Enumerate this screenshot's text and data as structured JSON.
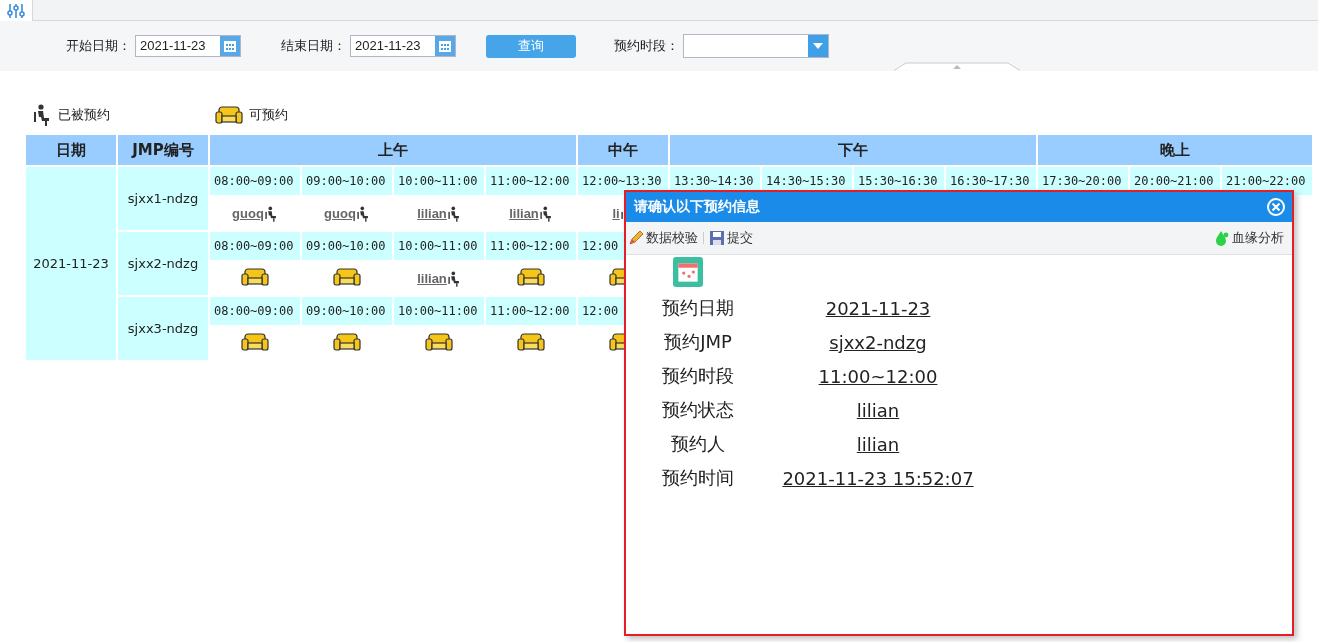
{
  "filter": {
    "start_label": "开始日期：",
    "start_value": "2021-11-23",
    "end_label": "结束日期：",
    "end_value": "2021-11-23",
    "query_button": "查询",
    "period_label": "预约时段："
  },
  "legend": [
    {
      "kind": "booked",
      "label": "已被预约"
    },
    {
      "kind": "free",
      "label": "可预约"
    }
  ],
  "table": {
    "columns": [
      "日期",
      "JMP编号"
    ],
    "period_labels": [
      "上午",
      "中午",
      "下午",
      "晚上"
    ],
    "date": "2021-11-23",
    "rows": [
      {
        "jmp": "sjxx1-ndzg",
        "periods": [
          [
            {
              "time": "08:00~09:00",
              "kind": "booked",
              "user": "guoq"
            },
            {
              "time": "09:00~10:00",
              "kind": "booked",
              "user": "guoq"
            },
            {
              "time": "10:00~11:00",
              "kind": "booked",
              "user": "lilian"
            },
            {
              "time": "11:00~12:00",
              "kind": "booked",
              "user": "lilian"
            }
          ],
          [
            {
              "time": "12:00~13:30",
              "kind": "booked",
              "user": "li"
            }
          ],
          [
            {
              "time": "13:30~14:30"
            },
            {
              "time": "14:30~15:30"
            },
            {
              "time": "15:30~16:30"
            },
            {
              "time": "16:30~17:30"
            }
          ],
          [
            {
              "time": "17:30~20:00"
            },
            {
              "time": "20:00~21:00"
            },
            {
              "time": "21:00~22:00"
            }
          ]
        ]
      },
      {
        "jmp": "sjxx2-ndzg",
        "periods": [
          [
            {
              "time": "08:00~09:00",
              "kind": "free"
            },
            {
              "time": "09:00~10:00",
              "kind": "free"
            },
            {
              "time": "10:00~11:00",
              "kind": "booked",
              "user": "lilian"
            },
            {
              "time": "11:00~12:00",
              "kind": "free"
            }
          ],
          [
            {
              "time": "12:00",
              "kind": "free"
            }
          ]
        ]
      },
      {
        "jmp": "sjxx3-ndzg",
        "periods": [
          [
            {
              "time": "08:00~09:00",
              "kind": "free"
            },
            {
              "time": "09:00~10:00",
              "kind": "free"
            },
            {
              "time": "10:00~11:00",
              "kind": "free"
            },
            {
              "time": "11:00~12:00",
              "kind": "free"
            }
          ],
          [
            {
              "time": "12:00",
              "kind": "free"
            }
          ]
        ]
      }
    ]
  },
  "dialog": {
    "title": "请确认以下预约信息",
    "toolbar": [
      {
        "kind": "pencil",
        "label": "数据校验"
      },
      {
        "kind": "save",
        "label": "提交"
      }
    ],
    "toolbar_right": {
      "kind": "drop",
      "label": "血缘分析"
    },
    "fields": [
      {
        "label": "预约日期",
        "value": "2021-11-23"
      },
      {
        "label": "预约JMP",
        "value": "sjxx2-ndzg"
      },
      {
        "label": "预约时段",
        "value": "11:00~12:00"
      },
      {
        "label": "预约状态",
        "value": "lilian"
      },
      {
        "label": "预约人",
        "value": "lilian"
      },
      {
        "label": "预约时间",
        "value": "2021-11-23 15:52:07"
      }
    ]
  }
}
